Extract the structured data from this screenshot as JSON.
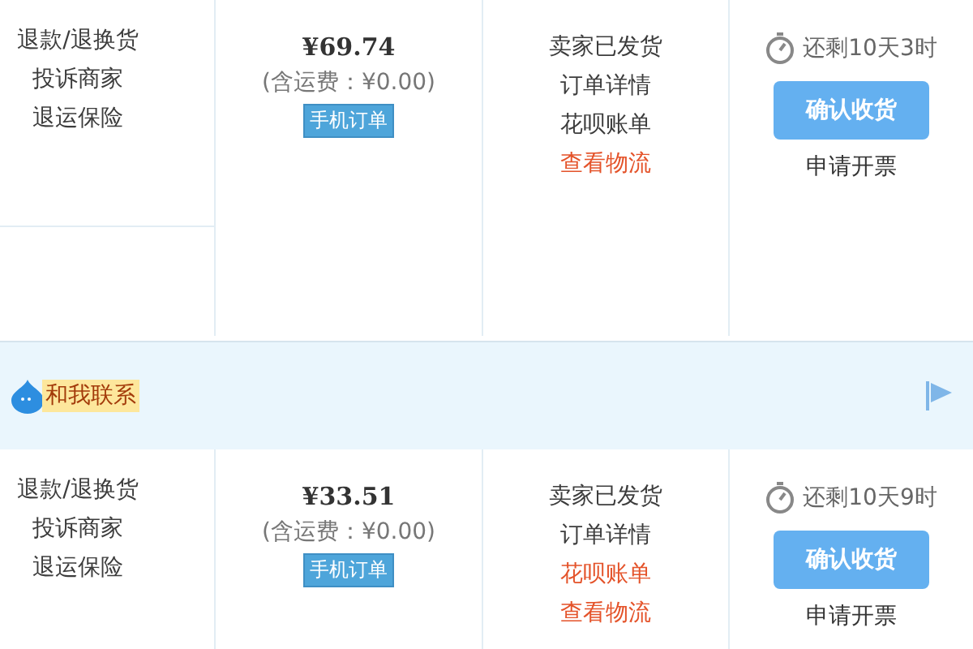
{
  "orders": [
    {
      "service_links": [
        "退款/退换货",
        "投诉商家",
        "退运保险"
      ],
      "price": "¥69.74",
      "shipping": "(含运费：¥0.00)",
      "badge": "手机订单",
      "status_links": [
        {
          "label": "卖家已发货",
          "highlighted": false
        },
        {
          "label": "订单详情",
          "highlighted": false
        },
        {
          "label": "花呗账单",
          "highlighted": false
        },
        {
          "label": "查看物流",
          "highlighted": true
        }
      ],
      "countdown": "还剩10天3时",
      "confirm_button": "确认收货",
      "invoice_link": "申请开票"
    },
    {
      "header": {
        "contact_label": "和我联系"
      },
      "service_links": [
        "退款/退换货",
        "投诉商家",
        "退运保险"
      ],
      "price": "¥33.51",
      "shipping": "(含运费：¥0.00)",
      "badge": "手机订单",
      "status_links": [
        {
          "label": "卖家已发货",
          "highlighted": false
        },
        {
          "label": "订单详情",
          "highlighted": false
        },
        {
          "label": "花呗账单",
          "highlighted": true
        },
        {
          "label": "查看物流",
          "highlighted": true
        }
      ],
      "countdown": "还剩10天9时",
      "confirm_button": "确认收货",
      "invoice_link": "申请开票"
    }
  ]
}
